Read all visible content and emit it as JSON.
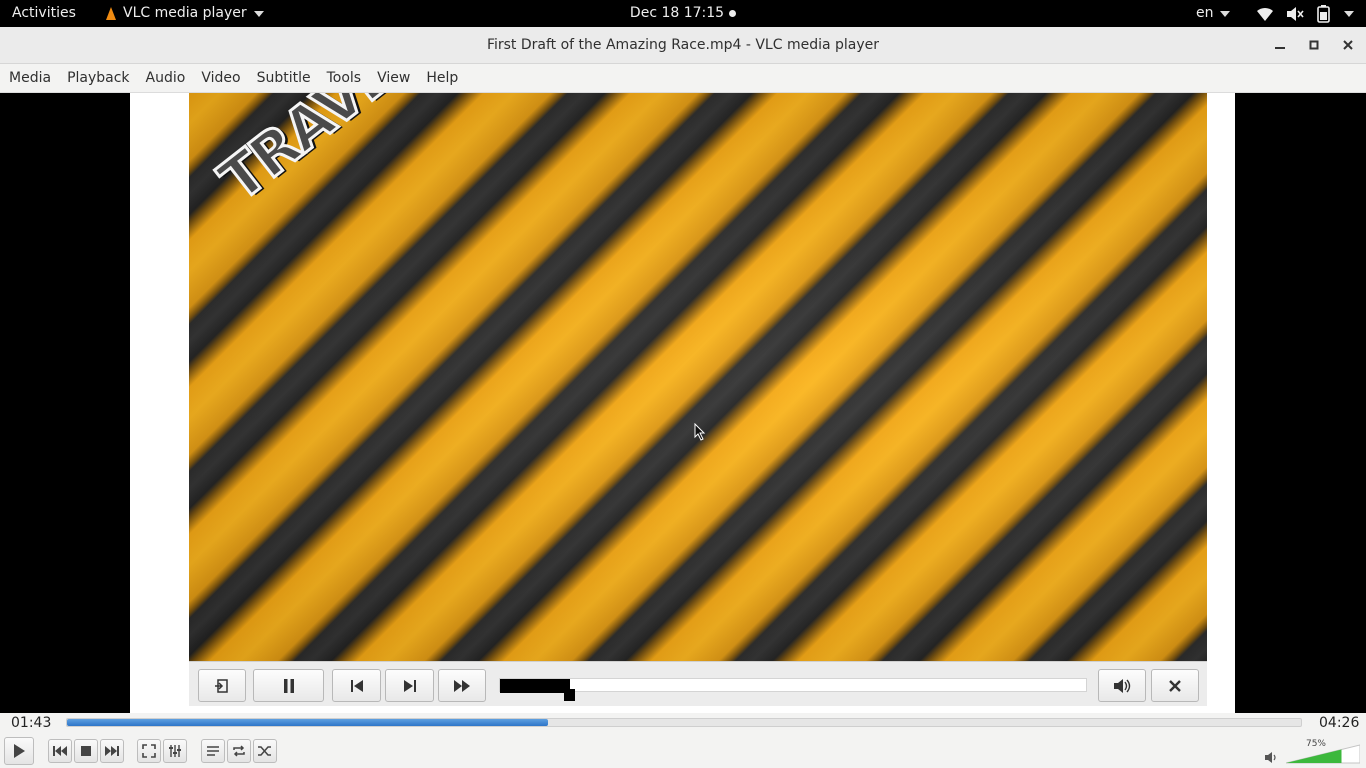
{
  "topbar": {
    "activities": "Activities",
    "app_menu": "VLC media player",
    "clock": "Dec 18  17:15",
    "language": "en"
  },
  "window": {
    "title": "First Draft of the Amazing Race.mp4 - VLC media player"
  },
  "menu": [
    "Media",
    "Playback",
    "Audio",
    "Video",
    "Subtitle",
    "Tools",
    "View",
    "Help"
  ],
  "video": {
    "logo_text": "TRAVEL",
    "overlay_seek_fraction": 0.12
  },
  "playback": {
    "elapsed": "01:43",
    "total": "04:26",
    "progress_fraction": 0.39
  },
  "volume": {
    "level_label": "75%",
    "level_fraction": 0.75
  },
  "colors": {
    "accent": "#2d75c8",
    "volume_green": "#3cb83c",
    "stripe_yellow": "#f5a813",
    "stripe_dark": "#2b2b2b"
  }
}
